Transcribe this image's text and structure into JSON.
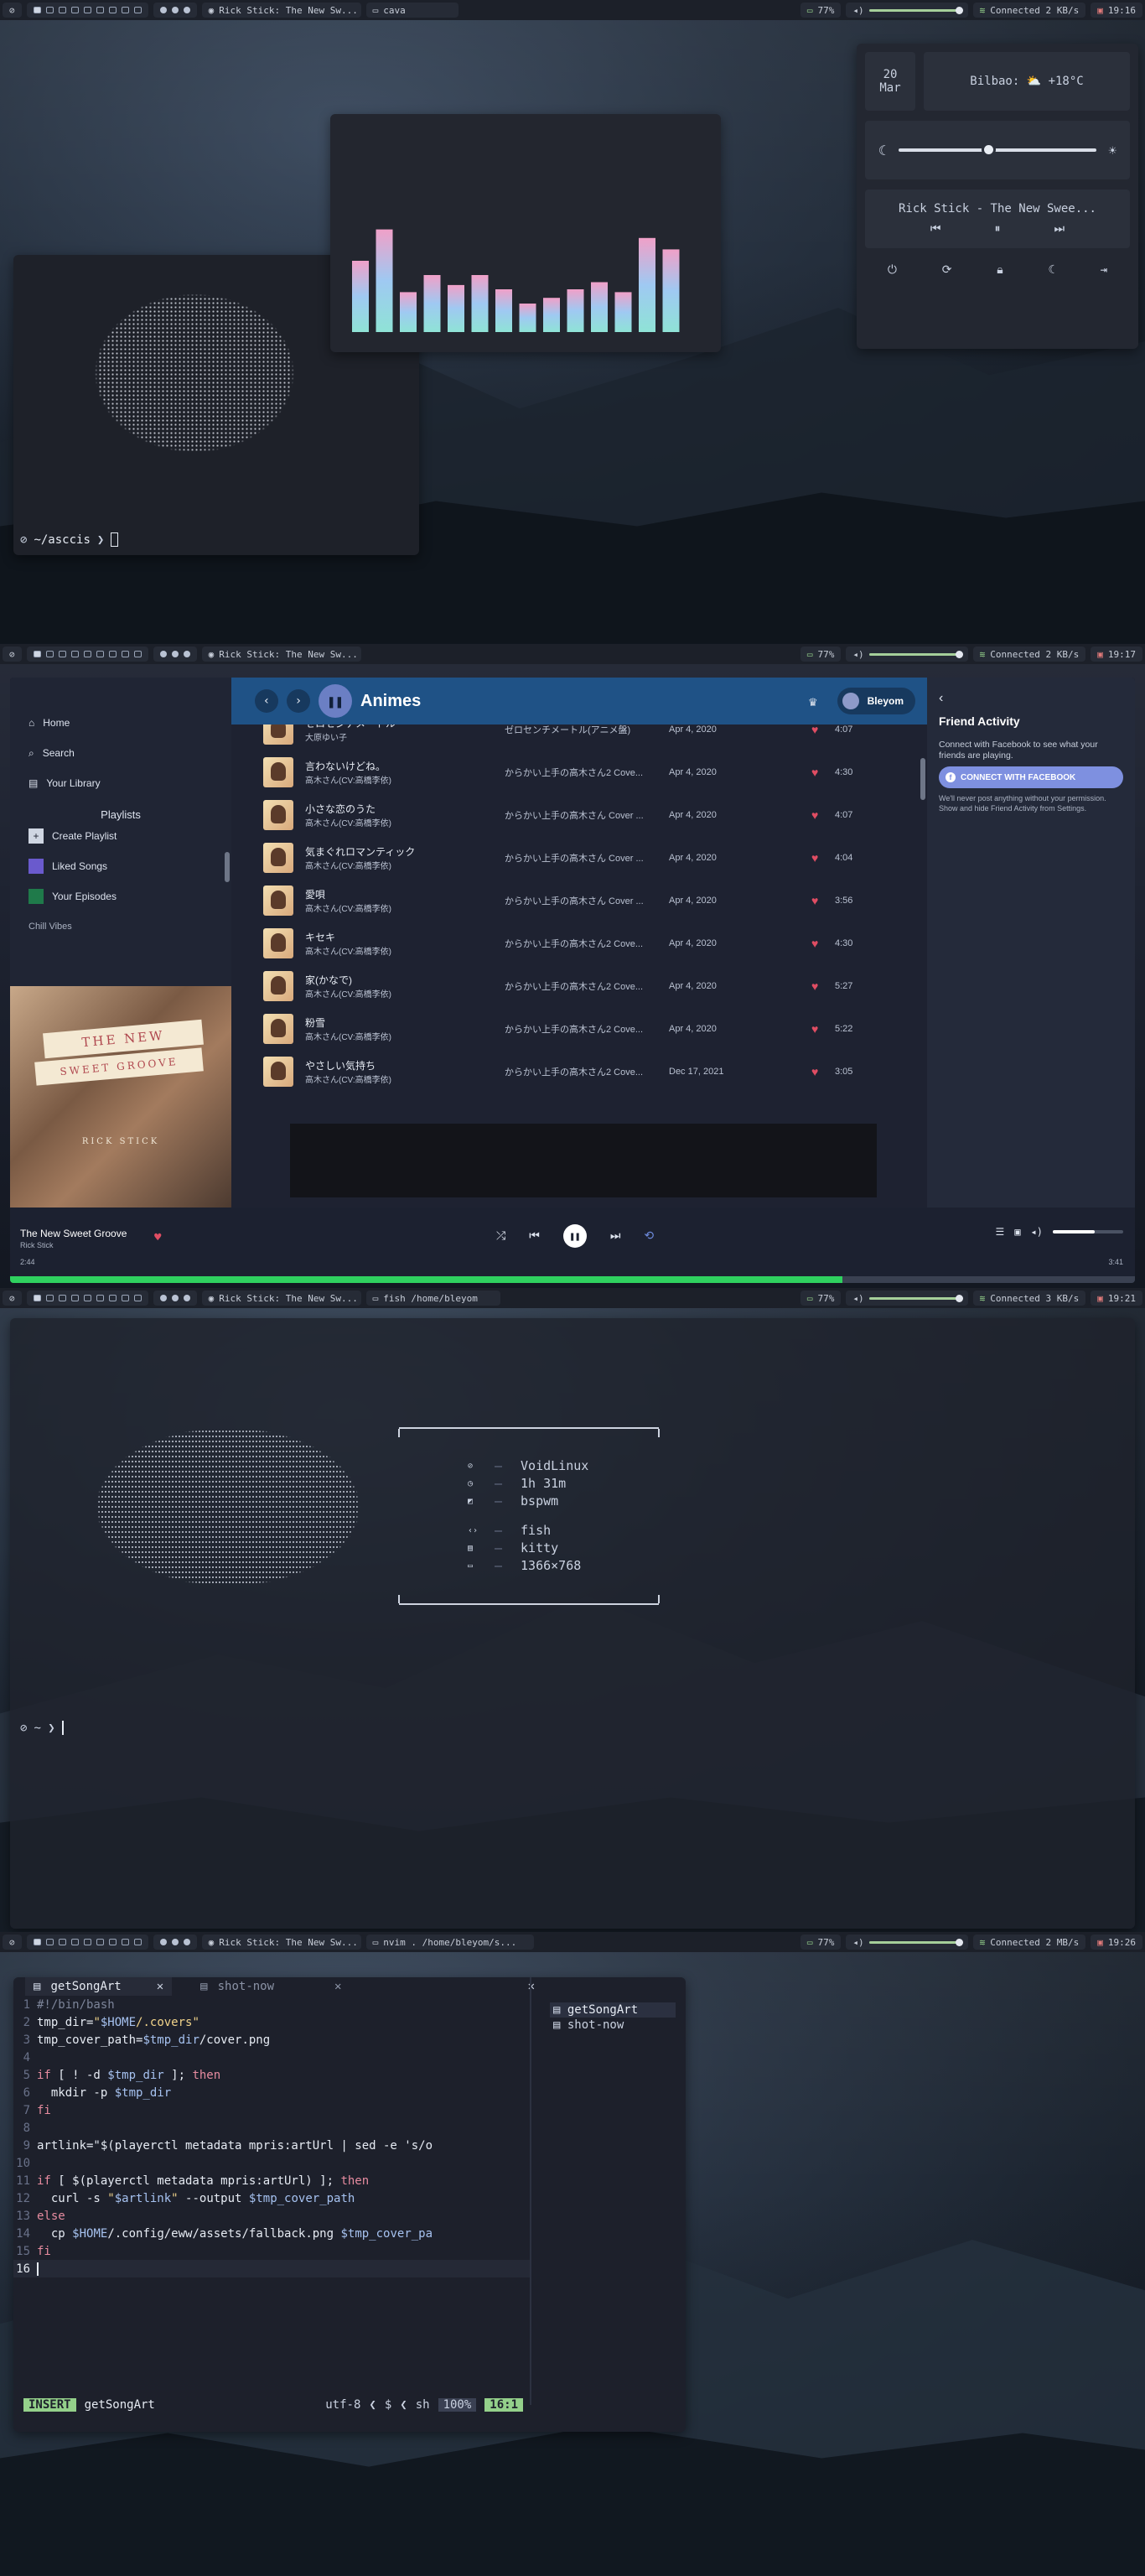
{
  "bar": {
    "ws_icon": "void-icon",
    "title1": "Rick Stick: The New Sw...",
    "title2": "Rick Stick: The New Sw...",
    "window1": "cava",
    "window3": "fish /home/bleyom",
    "window4": "nvim . /home/bleyom/s...",
    "battery": "77%",
    "net1": "Connected 2 KB/s",
    "net2": "Connected 2 KB/s",
    "net3": "Connected 3 KB/s",
    "net4": "Connected 2 MB/s",
    "time1": "19:16",
    "time2": "19:17",
    "time3": "19:21",
    "time4": "19:26"
  },
  "terminal1": {
    "prompt": "~/asccis",
    "cursor": "❯"
  },
  "widget": {
    "date_day": "20",
    "date_month": "Mar",
    "weather": "Bilbao: ⛅ +18°C",
    "brightness": 0.42,
    "song": "Rick Stick - The New Swee...",
    "buttons": [
      "power-icon",
      "reboot-icon",
      "lock-icon",
      "sleep-icon",
      "logout-icon"
    ]
  },
  "cava": {
    "bars": [
      0.5,
      0.72,
      0.28,
      0.4,
      0.33,
      0.4,
      0.3,
      0.2,
      0.24,
      0.3,
      0.35,
      0.28,
      0.66,
      0.58
    ]
  },
  "spotify": {
    "nav": [
      "Home",
      "Search",
      "Your Library"
    ],
    "playlists_header": "Playlists",
    "create": "Create Playlist",
    "liked": "Liked Songs",
    "episodes": "Your Episodes",
    "chill": "Chill Vibes",
    "cover_line1": "THE NEW",
    "cover_line2": "SWEET GROOVE",
    "cover_artist": "RICK STICK",
    "playlist_title": "Animes",
    "user": "Bleyom",
    "tracks": [
      {
        "title": "ゼロセンチメートル",
        "artist": "大原ゆい子",
        "album": "ゼロセンチメートル(アニメ盤)",
        "date": "Apr 4, 2020",
        "dur": "4:07"
      },
      {
        "title": "言わないけどね。",
        "artist": "高木さん(CV:高橋李依)",
        "album": "からかい上手の高木さん2 Cove...",
        "date": "Apr 4, 2020",
        "dur": "4:30"
      },
      {
        "title": "小さな恋のうた",
        "artist": "高木さん(CV:高橋李依)",
        "album": "からかい上手の高木さん Cover ...",
        "date": "Apr 4, 2020",
        "dur": "4:07"
      },
      {
        "title": "気まぐれロマンティック",
        "artist": "高木さん(CV:高橋李依)",
        "album": "からかい上手の高木さん Cover ...",
        "date": "Apr 4, 2020",
        "dur": "4:04"
      },
      {
        "title": "愛唄",
        "artist": "高木さん(CV:高橋李依)",
        "album": "からかい上手の高木さん Cover ...",
        "date": "Apr 4, 2020",
        "dur": "3:56"
      },
      {
        "title": "キセキ",
        "artist": "高木さん(CV:高橋李依)",
        "album": "からかい上手の高木さん2 Cove...",
        "date": "Apr 4, 2020",
        "dur": "4:30"
      },
      {
        "title": "家(かなで)",
        "artist": "高木さん(CV:高橋李依)",
        "album": "からかい上手の高木さん2 Cove...",
        "date": "Apr 4, 2020",
        "dur": "5:27"
      },
      {
        "title": "粉雪",
        "artist": "高木さん(CV:高橋李依)",
        "album": "からかい上手の高木さん2 Cove...",
        "date": "Apr 4, 2020",
        "dur": "5:22"
      },
      {
        "title": "やさしい気持ち",
        "artist": "高木さん(CV:高橋李依)",
        "album": "からかい上手の高木さん2 Cove...",
        "date": "Dec 17, 2021",
        "dur": "3:05"
      }
    ],
    "friend_title": "Friend Activity",
    "friend_text": "Connect with Facebook to see what your friends are playing.",
    "fb_button": "CONNECT WITH FACEBOOK",
    "friend_note": "We'll never post anything without your permission. Show and hide Friend Activity from Settings.",
    "now_title": "The New Sweet Groove",
    "now_artist": "Rick Stick",
    "elapsed": "2:44",
    "total": "3:41",
    "progress": 0.74,
    "volume": 0.6
  },
  "fetch": {
    "lines": [
      {
        "icon": "os-icon",
        "value": "VoidLinux"
      },
      {
        "icon": "uptime-icon",
        "value": "1h 31m"
      },
      {
        "icon": "wm-icon",
        "value": "bspwm"
      },
      {
        "icon": "shell-icon",
        "value": "fish"
      },
      {
        "icon": "terminal-icon",
        "value": "kitty"
      },
      {
        "icon": "display-icon",
        "value": "1366×768"
      }
    ],
    "prompt": "~ ❯"
  },
  "nvim": {
    "tab1": "getSongArt",
    "tab2": "shot-now",
    "tree": [
      "getSongArt",
      "shot-now"
    ],
    "code": [
      "#!/bin/bash",
      "tmp_dir=\"$HOME/.covers\"",
      "tmp_cover_path=$tmp_dir/cover.png",
      "",
      "if [ ! -d $tmp_dir ]; then",
      "  mkdir -p $tmp_dir",
      "fi",
      "",
      "artlink=\"$(playerctl metadata mpris:artUrl | sed -e 's/o",
      "",
      "if [ $(playerctl metadata mpris:artUrl) ]; then",
      "  curl -s \"$artlink\" --output $tmp_cover_path",
      "else",
      "  cp $HOME/.config/eww/assets/fallback.png $tmp_cover_pa",
      "fi",
      ""
    ],
    "mode": "INSERT",
    "file": "getSongArt",
    "enc": "utf-8",
    "ft": "sh",
    "percent": "100%",
    "pos": "16:1"
  }
}
